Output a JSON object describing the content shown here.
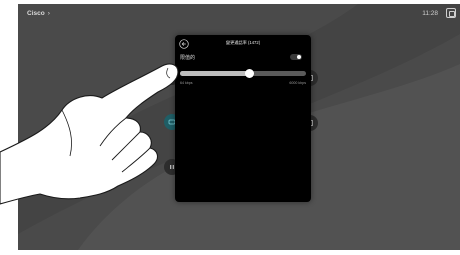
{
  "header": {
    "brand": "Cisco",
    "brand_chevron": "›",
    "time": "11:28"
  },
  "background": {
    "button_labels": [
      "",
      "",
      ""
    ]
  },
  "dialog": {
    "title": "變更通話率 (1472)",
    "option_label": "限值的",
    "toggle_on": true,
    "slider": {
      "min_label": "64 kbps",
      "max_label": "6000 kbps",
      "fraction": 0.55
    }
  },
  "colors": {
    "screen": "#4a4a4a",
    "dialog": "#000000",
    "teal": "#1f5e66"
  },
  "icons": [
    "back-arrow-icon",
    "fullscreen-icon",
    "hand-pointer"
  ]
}
